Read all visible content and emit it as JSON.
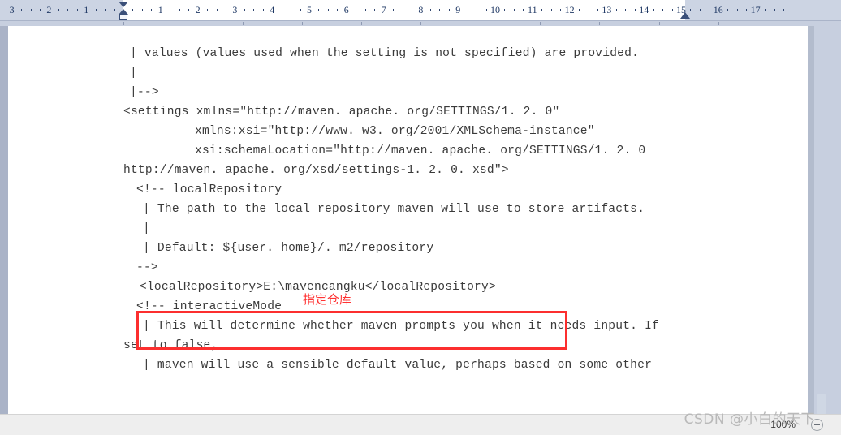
{
  "window": {
    "app": "word-processor",
    "background_color": "#c7cfdf",
    "page_color": "#ffffff"
  },
  "ruler": {
    "name": "horizontal-ruler",
    "unit": "cm",
    "left_labels": [
      "3",
      "2",
      "1"
    ],
    "right_labels": [
      "1",
      "2",
      "3",
      "4",
      "5",
      "6",
      "7",
      "8",
      "9",
      "10",
      "11",
      "12",
      "13",
      "14",
      "15",
      "16",
      "17"
    ],
    "indent_markers": {
      "first_line_indent": "first-line-indent-marker",
      "hanging_indent": "hanging-indent-marker",
      "left_indent": "left-indent-marker",
      "right_indent": "right-indent-marker"
    }
  },
  "document": {
    "name": "maven-settings-xml",
    "lines": [
      {
        "indent": 160,
        "text": "| values (values used when the setting is not specified) are provided."
      },
      {
        "indent": 160,
        "text": "|"
      },
      {
        "indent": 160,
        "text": "|-->"
      },
      {
        "indent": 152,
        "text": "<settings xmlns=\"http://maven. apache. org/SETTINGS/1. 2. 0\""
      },
      {
        "indent": 240,
        "text": "xmlns:xsi=\"http://www. w3. org/2001/XMLSchema-instance\""
      },
      {
        "indent": 240,
        "text": "xsi:schemaLocation=\"http://maven. apache. org/SETTINGS/1. 2. 0"
      },
      {
        "indent": 152,
        "text": "http://maven. apache. org/xsd/settings-1. 2. 0. xsd\">"
      },
      {
        "indent": 168,
        "text": "<!-- localRepository"
      },
      {
        "indent": 176,
        "text": "| The path to the local repository maven will use to store artifacts."
      },
      {
        "indent": 176,
        "text": "|"
      },
      {
        "indent": 176,
        "text": "| Default: ${user. home}/. m2/repository"
      },
      {
        "indent": 168,
        "text": "-->"
      },
      {
        "indent": 172,
        "text": "<localRepository>E:\\mavencangku</localRepository>"
      },
      {
        "indent": 168,
        "text": "<!-- interactiveMode"
      },
      {
        "indent": 176,
        "text": "| This will determine whether maven prompts you when it needs input. If"
      },
      {
        "indent": 152,
        "text": "set to false,"
      },
      {
        "indent": 176,
        "text": "| maven will use a sensible default value, perhaps based on some other"
      }
    ]
  },
  "annotation": {
    "label_text": "指定仓库",
    "label_color": "#ff3333",
    "box_color": "#fc2f2f",
    "box_target_line": "<localRepository>E:\\mavencangku</localRepository>"
  },
  "status_bar": {
    "zoom_level": "100%",
    "zoom_out_icon": "minus-circle-icon"
  },
  "watermark": {
    "text": "CSDN @小白的天下",
    "color": "#b9b9b9"
  }
}
